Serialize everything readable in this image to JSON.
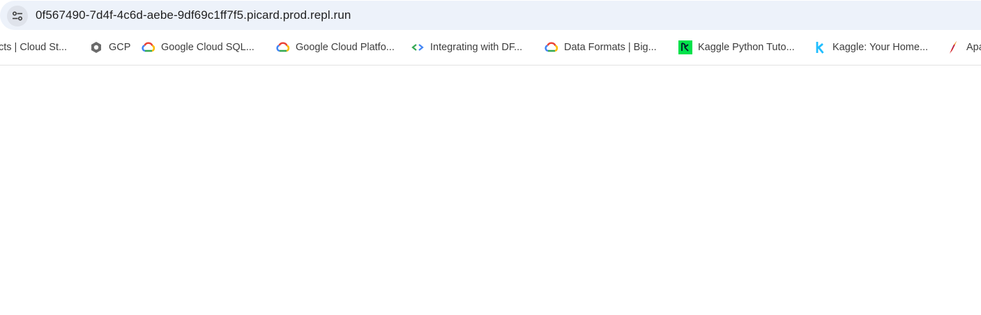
{
  "address_bar": {
    "site_info_icon": "tune-icon",
    "url": "0f567490-7d4f-4c6d-aebe-9df69c1ff7f5.picard.prod.repl.run"
  },
  "bookmarks": [
    {
      "label": "cts  |  Cloud St...",
      "icon": "none"
    },
    {
      "label": "GCP",
      "icon": "hexagon-icon"
    },
    {
      "label": "Google Cloud SQL...",
      "icon": "google-cloud-icon"
    },
    {
      "label": "Google Cloud Platfo...",
      "icon": "google-cloud-icon"
    },
    {
      "label": "Integrating with DF...",
      "icon": "code-brackets-icon"
    },
    {
      "label": "Data Formats  |  Big...",
      "icon": "google-cloud-icon"
    },
    {
      "label": "Kaggle Python Tuto...",
      "icon": "dc-green-icon"
    },
    {
      "label": "Kaggle: Your Home...",
      "icon": "kaggle-k-icon"
    },
    {
      "label": "Apa",
      "icon": "apache-feather-icon"
    }
  ],
  "colors": {
    "omnibox_bg": "#edf2fa",
    "bookmark_text": "#3c3c3c",
    "dc_green": "#00e24b",
    "kaggle_blue": "#20beff"
  }
}
